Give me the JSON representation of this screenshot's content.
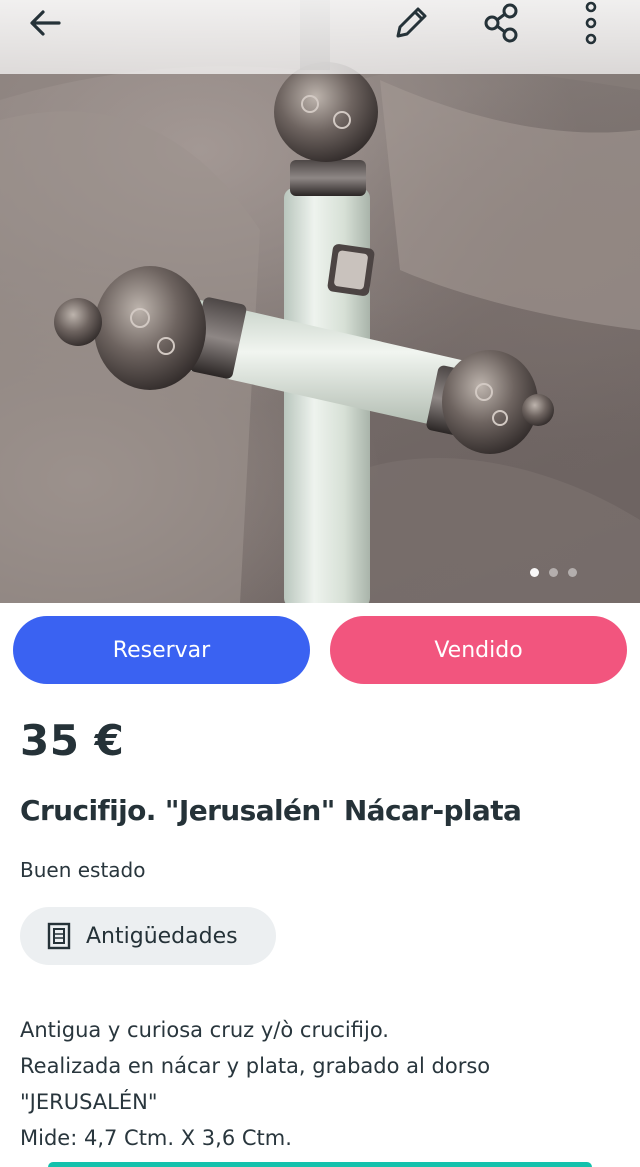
{
  "toolbar": {
    "back_icon": "arrow-left-icon",
    "edit_icon": "pencil-icon",
    "share_icon": "share-icon",
    "more_icon": "more-vertical-icon"
  },
  "gallery": {
    "image": "product-photo",
    "photo_count": 3,
    "active_photo": 1
  },
  "actions": {
    "reserve_label": "Reservar",
    "sold_label": "Vendido",
    "reserve_color": "#3a62f2",
    "sold_color": "#f2557e"
  },
  "product": {
    "price": "35 €",
    "title": "Crucifijo. \"Jerusalén\" Nácar-plata",
    "condition": "Buen estado",
    "category": {
      "label": "Antigüedades",
      "icon": "antiques-icon"
    },
    "description": "Antigua y curiosa cruz y/ò crucifijo.\nRealizada en nácar y plata, grabado al dorso\n\"JERUSALÉN\"\nMide: 4,7 Ctm. X 3,6 Ctm."
  },
  "colors": {
    "accent": "#13c1ac",
    "text": "#253238",
    "chip_bg": "#eceff1"
  }
}
